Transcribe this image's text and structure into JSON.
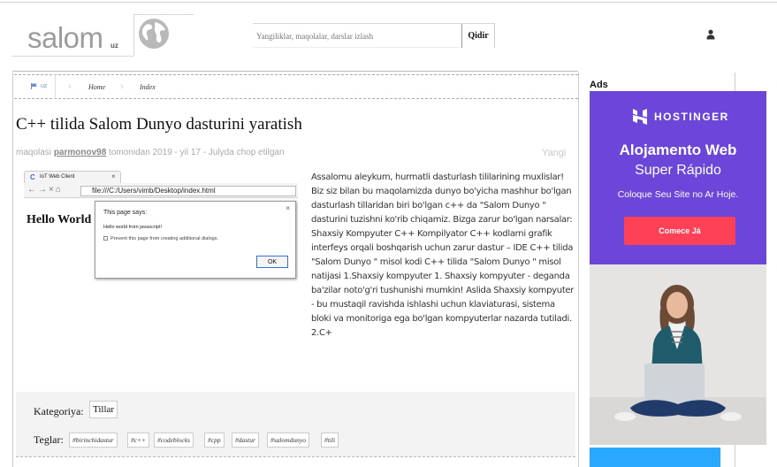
{
  "header": {
    "logo_text": "salom",
    "logo_sub": "uz",
    "search_placeholder": "Yangiliklar, maqolalar, darslar izlash",
    "search_button": "Qidir"
  },
  "breadcrumb": {
    "lang": "uz",
    "items": [
      "Home",
      "Index"
    ]
  },
  "article": {
    "title": "C++ tilida Salom Dunyo dasturini yaratish",
    "meta_prefix": "maqolasi ",
    "author": "parmonov98",
    "meta_suffix": " tomonidan 2019 - yil 17 - Julyda chop etilgan",
    "badge": "Yangi",
    "body": "Assalomu aleykum, hurmatli dasturlash tililarining muxlislar! Biz siz bilan bu maqolamizda dunyo bo'yicha mashhur bo'lgan dasturlash tillaridan biri bo'lgan c++ da \"Salom Dunyo \" dasturini tuzishni ko'rib chiqamiz. Bizga zarur bo'lgan narsalar: Shaxsiy Kompyuter C++ Kompilyator C++ kodlarni grafik interfeys orqali boshqarish uchun zarur dastur – IDE C++ tilida \"Salom Dunyo \" misol kodi C++ tilida \"Salom Dunyo \" misol natijasi 1.Shaxsiy kompyuter 1. Shaxsiy kompyuter - deganda ba'zilar noto'g'ri tushunishi mumkin! Aslida Shaxsiy kompyuter - bu mustaqil ravishda ishlashi uchun klaviaturasi, sistema bloki va monitoriga ega bo'lgan kompyuterlar nazarda tutiladi. 2.C+"
  },
  "screenshot": {
    "tab_title": "IoT Web Client",
    "url": "file:///C:/Users/vimb/Desktop/index.html",
    "page_heading": "Hello World",
    "dialog_title": "This page says:",
    "dialog_message": "Hello world from javascript!",
    "dialog_checkbox": "Prevent this page from creating additional dialogs.",
    "dialog_ok": "OK"
  },
  "taxonomy": {
    "category_label": "Kategoriya:",
    "category": "Tillar",
    "tags_label": "Teglar:",
    "tags": [
      "#birinchidastur",
      "#c++",
      "#codeblocks",
      "#cpp",
      "#dastur",
      "#salomdunyo",
      "#tili"
    ]
  },
  "sidebar": {
    "ads_label": "Ads",
    "ad_brand": "HOSTINGER",
    "ad_headline": "Alojamento Web",
    "ad_subheadline": "Super Rápido",
    "ad_text": "Coloque Seu Site no Ar Hoje.",
    "ad_button": "Comece Já",
    "ad_color": "#6b46d9",
    "ad_button_color": "#ff4158"
  }
}
